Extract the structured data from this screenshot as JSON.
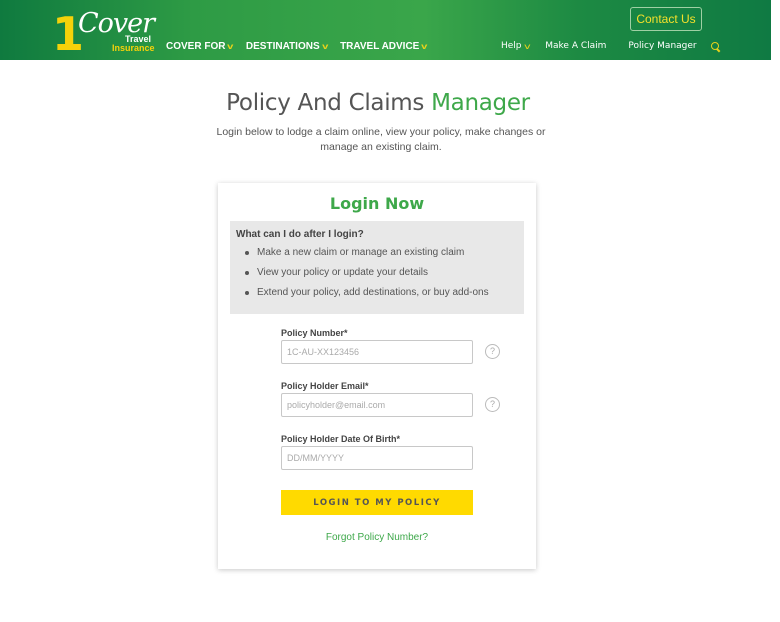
{
  "header": {
    "logo": {
      "number": "1",
      "word": "Cover",
      "line1": "Travel",
      "line2": "Insurance"
    },
    "main_nav": [
      {
        "label": "COVER FOR",
        "has_dropdown": true
      },
      {
        "label": "DESTINATIONS",
        "has_dropdown": true
      },
      {
        "label": "TRAVEL ADVICE",
        "has_dropdown": true
      }
    ],
    "secondary_nav": [
      {
        "label": "Help",
        "has_dropdown": true
      },
      {
        "label": "Make A Claim"
      },
      {
        "label": "Policy Manager"
      }
    ],
    "search_icon": "search-icon",
    "contact_button": "Contact Us",
    "chevron_glyph": "v"
  },
  "page": {
    "title_main": "Policy And Claims ",
    "title_accent": "Manager",
    "subtitle": "Login below to lodge a claim online, view your policy, make changes or manage an existing claim."
  },
  "login_card": {
    "title": "Login Now",
    "info_title": "What can I do after I login?",
    "info_items": [
      "Make a new claim or manage an existing claim",
      "View your policy or update your details",
      "Extend your policy, add destinations, or buy add-ons"
    ],
    "fields": [
      {
        "label": "Policy Number*",
        "placeholder": "1C-AU-XX123456",
        "value": "",
        "has_help": true
      },
      {
        "label": "Policy Holder Email*",
        "placeholder": "policyholder@email.com",
        "value": "",
        "has_help": true
      },
      {
        "label": "Policy Holder Date Of Birth*",
        "placeholder": "DD/MM/YYYY",
        "value": "",
        "has_help": false
      }
    ],
    "help_glyph": "?",
    "login_button": "LOGIN TO MY POLICY",
    "forgot_link": "Forgot Policy Number?"
  },
  "colors": {
    "brand_green": "#2e9b45",
    "accent_green": "#3ea84a",
    "brand_yellow": "#ffda00"
  }
}
